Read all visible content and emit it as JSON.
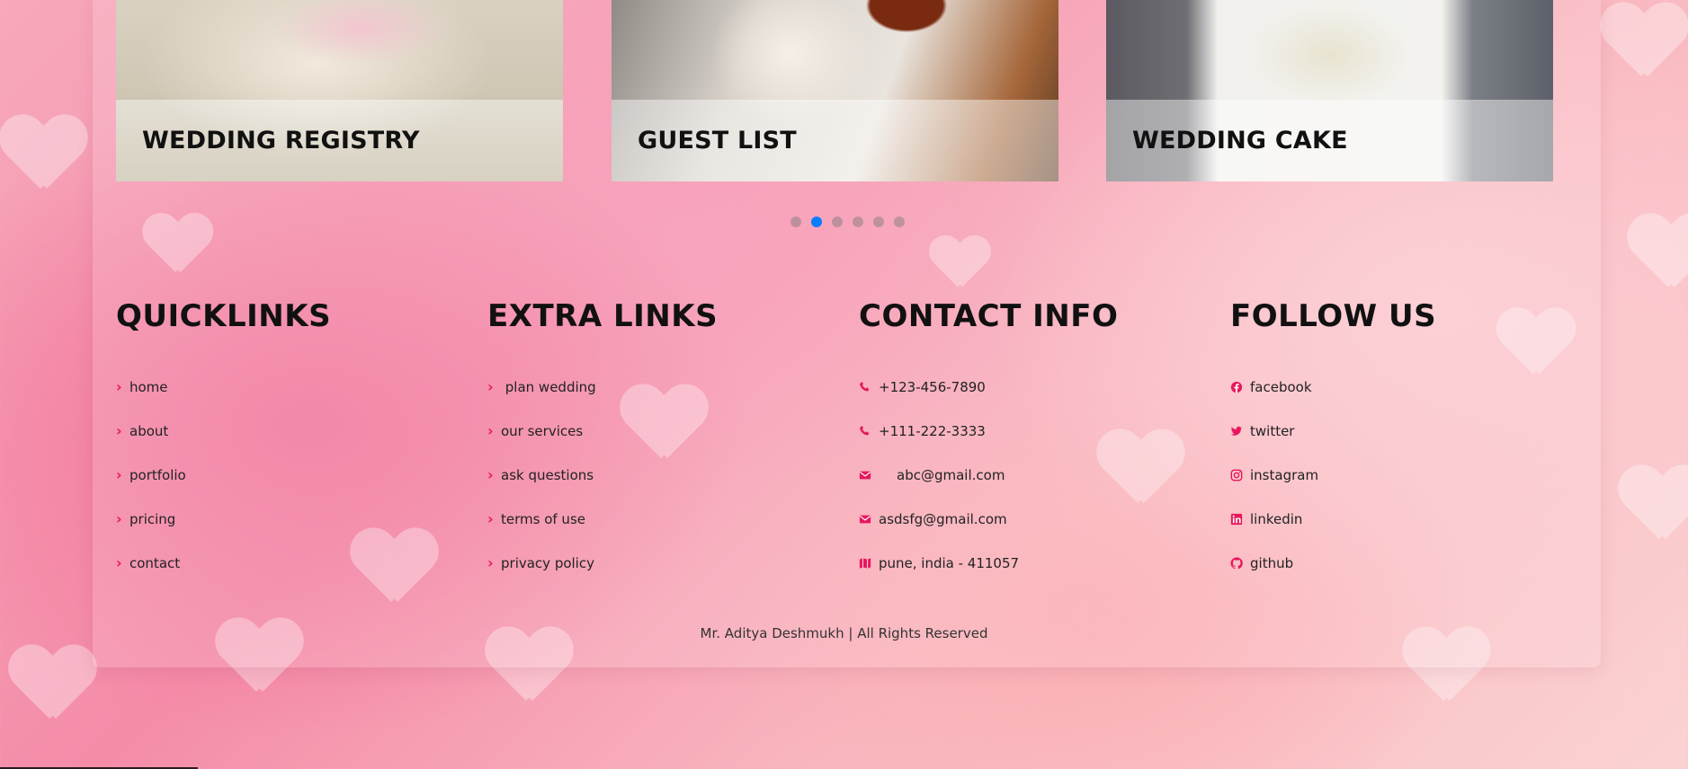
{
  "cards": [
    {
      "title": "WEDDING REGISTRY"
    },
    {
      "title": "GUEST LIST"
    },
    {
      "title": "WEDDING CAKE"
    }
  ],
  "carousel": {
    "count": 6,
    "active_index": 1
  },
  "quicklinks": {
    "title": "QUICKLINKS",
    "items": [
      "home",
      "about",
      "portfolio",
      "pricing",
      "contact"
    ]
  },
  "extralinks": {
    "title": "EXTRA LINKS",
    "items": [
      " plan wedding",
      "our services",
      "ask questions",
      "terms of use",
      "privacy policy"
    ]
  },
  "contact": {
    "title": "CONTACT INFO",
    "items": [
      {
        "icon": "phone-icon",
        "text": "+123-456-7890"
      },
      {
        "icon": "phone-icon",
        "text": "+111-222-3333"
      },
      {
        "icon": "envelope-icon",
        "text": "abc@gmail.com"
      },
      {
        "icon": "envelope-icon",
        "text": "asdsfg@gmail.com"
      },
      {
        "icon": "map-icon",
        "text": "pune, india - 411057"
      }
    ]
  },
  "follow": {
    "title": "FOLLOW US",
    "items": [
      {
        "icon": "facebook-icon",
        "text": "facebook"
      },
      {
        "icon": "twitter-icon",
        "text": "twitter"
      },
      {
        "icon": "instagram-icon",
        "text": "instagram"
      },
      {
        "icon": "linkedin-icon",
        "text": "linkedin"
      },
      {
        "icon": "github-icon",
        "text": "github"
      }
    ]
  },
  "footer": {
    "credit": "Mr. Aditya Deshmukh | All Rights Reserved"
  },
  "colors": {
    "accent": "#e8175d",
    "active_dot": "#0a7cff"
  }
}
